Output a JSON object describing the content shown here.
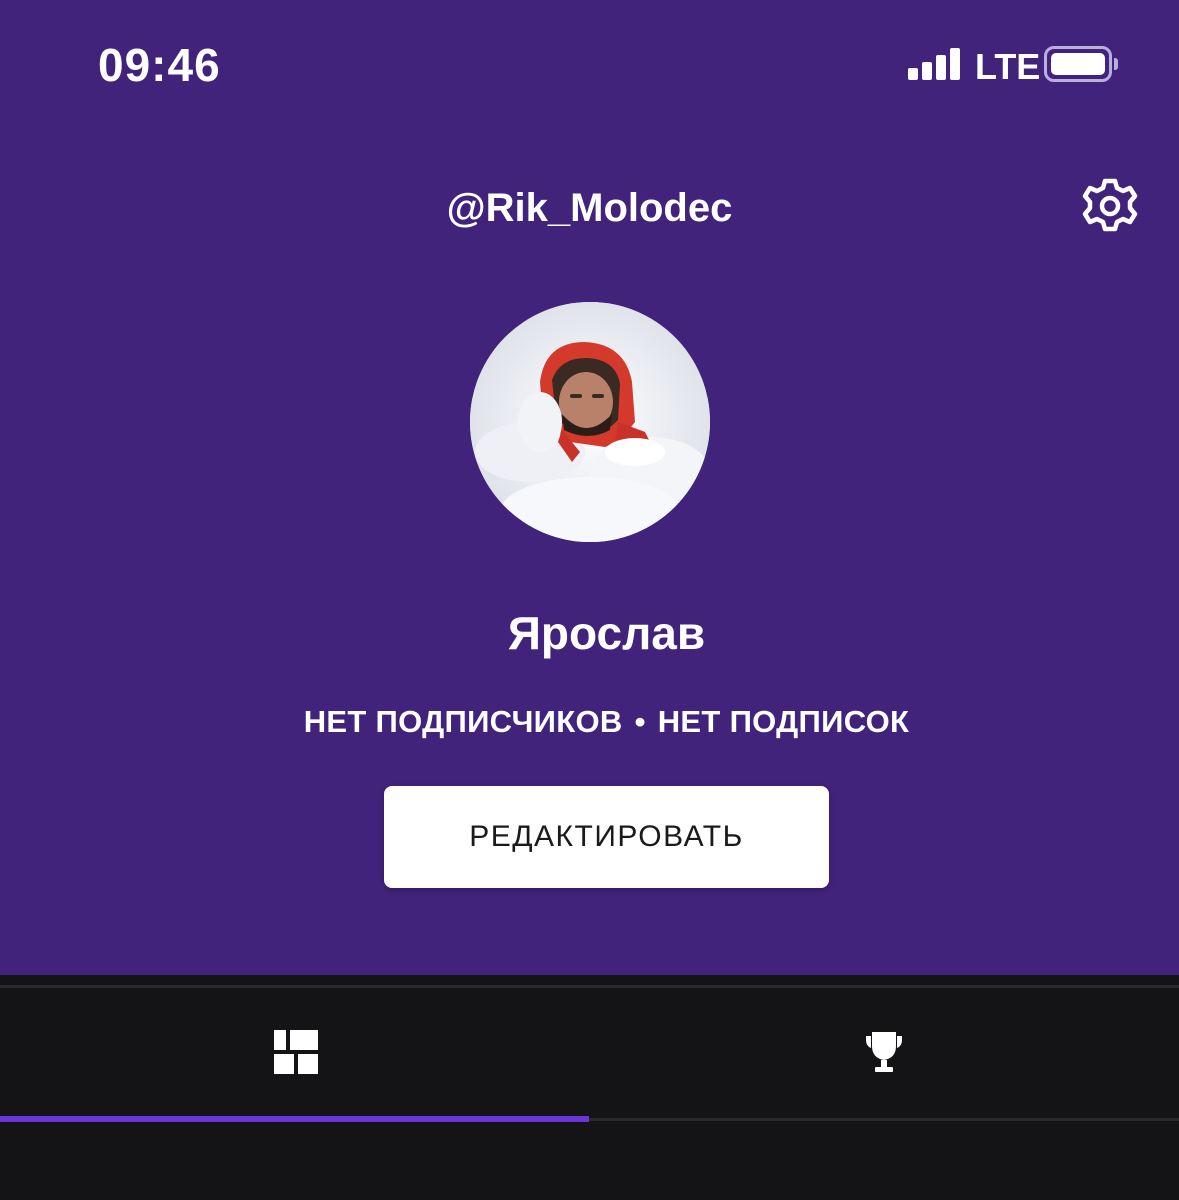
{
  "status_bar": {
    "time": "09:46",
    "network": "LTE",
    "signal_bars": 4,
    "battery_icon": "battery-full-icon"
  },
  "header": {
    "username": "@Rik_Molodec",
    "settings_icon": "gear-icon"
  },
  "profile": {
    "avatar_description_icon": "avatar",
    "display_name": "Ярослав",
    "followers_label": "НЕТ ПОДПИСЧИКОВ",
    "separator": "•",
    "following_label": "НЕТ ПОДПИСОК",
    "edit_button_label": "РЕДАКТИРОВАТЬ"
  },
  "tabs": [
    {
      "icon": "grid-icon",
      "active": true
    },
    {
      "icon": "trophy-icon",
      "active": false
    }
  ],
  "colors": {
    "profile_background": "#41237c",
    "page_background": "#141316",
    "tab_indicator": "#6a35d8",
    "button_background": "#ffffff"
  }
}
